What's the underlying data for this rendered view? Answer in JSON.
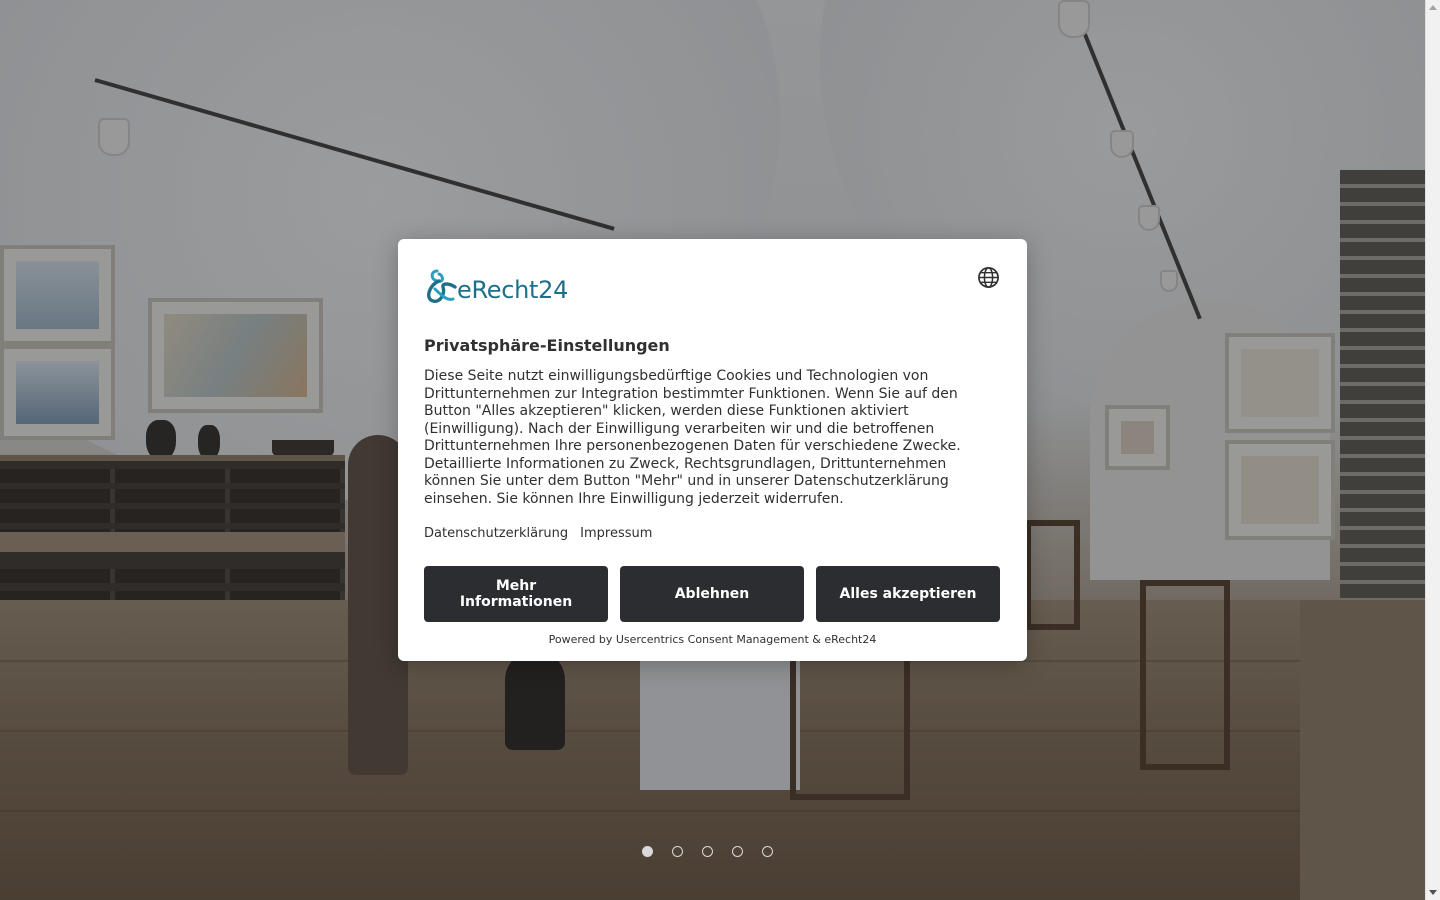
{
  "consent": {
    "brand": "eRecht24",
    "language_icon": "globe-icon",
    "title": "Privatsphäre-Einstellungen",
    "description": "Diese Seite nutzt einwilligungsbedürftige Cookies und Technologien von Drittunternehmen zur Integration bestimmter Funktionen. Wenn Sie auf den Button \"Alles akzeptieren\" klicken, werden diese Funktionen aktiviert (Einwilligung). Nach der Einwilligung verarbeiten wir und die betroffenen Drittunternehmen Ihre personenbezogenen Daten für verschiedene Zwecke. Detaillierte Informationen zu Zweck, Rechtsgrundlagen, Drittunternehmen können Sie unter dem Button \"Mehr\" und in unserer Datenschutzerklärung einsehen. Sie können Ihre Einwilligung jederzeit widerrufen.",
    "links": {
      "privacy": "Datenschutzerklärung",
      "imprint": "Impressum"
    },
    "buttons": {
      "more": "Mehr Informationen",
      "deny": "Ablehnen",
      "accept": "Alles akzeptieren"
    },
    "powered_by": "Powered by Usercentrics Consent Management & eRecht24",
    "colors": {
      "brand": "#1f6f8b",
      "button_bg": "#2b2d30",
      "button_text": "#ffffff"
    }
  },
  "slider": {
    "slide_count": 5,
    "active_index": 0
  }
}
